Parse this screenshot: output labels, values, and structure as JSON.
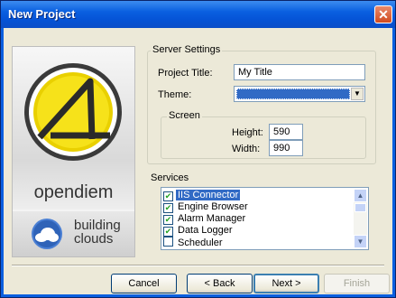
{
  "window": {
    "title": "New Project",
    "close_glyph": "✕"
  },
  "logo": {
    "brand_text": "opendiem",
    "secondary_line1": "building",
    "secondary_line2": "clouds"
  },
  "server_settings": {
    "legend": "Server Settings",
    "project_title_label": "Project Title:",
    "project_title_value": "My Title",
    "theme_label": "Theme:",
    "screen": {
      "legend": "Screen",
      "height_label": "Height:",
      "height_value": "590",
      "width_label": "Width:",
      "width_value": "990"
    }
  },
  "services": {
    "label": "Services",
    "items": [
      {
        "label": "IIS Connector",
        "checked": true,
        "selected": true
      },
      {
        "label": "Engine Browser",
        "checked": true,
        "selected": false
      },
      {
        "label": "Alarm Manager",
        "checked": true,
        "selected": false
      },
      {
        "label": "Data Logger",
        "checked": true,
        "selected": false
      },
      {
        "label": "Scheduler",
        "checked": false,
        "selected": false
      }
    ]
  },
  "buttons": {
    "cancel": "Cancel",
    "back": "< Back",
    "next": "Next >",
    "finish": "Finish"
  },
  "colors": {
    "titlebar": "#0a5fe0",
    "selection": "#316ac5",
    "face": "#ece9d8"
  }
}
